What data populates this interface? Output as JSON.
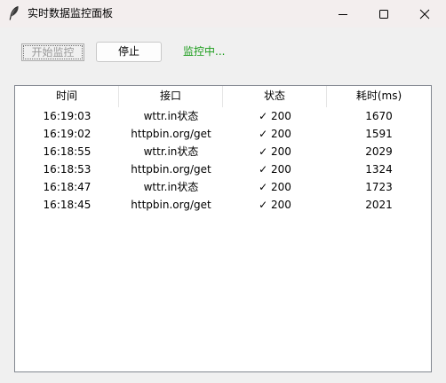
{
  "window": {
    "title": "实时数据监控面板",
    "icon": "feather-icon"
  },
  "toolbar": {
    "start_label": "开始监控",
    "stop_label": "停止",
    "status_text": "监控中...",
    "status_color": "#1a9c1a"
  },
  "table": {
    "columns": [
      "时间",
      "接口",
      "状态",
      "耗时(ms)"
    ],
    "rows": [
      {
        "time": "16:19:03",
        "api": "wttr.in状态",
        "status": "✓ 200",
        "duration": "1670"
      },
      {
        "time": "16:19:02",
        "api": "httpbin.org/get",
        "status": "✓ 200",
        "duration": "1591"
      },
      {
        "time": "16:18:55",
        "api": "wttr.in状态",
        "status": "✓ 200",
        "duration": "2029"
      },
      {
        "time": "16:18:53",
        "api": "httpbin.org/get",
        "status": "✓ 200",
        "duration": "1324"
      },
      {
        "time": "16:18:47",
        "api": "wttr.in状态",
        "status": "✓ 200",
        "duration": "1723"
      },
      {
        "time": "16:18:45",
        "api": "httpbin.org/get",
        "status": "✓ 200",
        "duration": "2021"
      }
    ]
  }
}
